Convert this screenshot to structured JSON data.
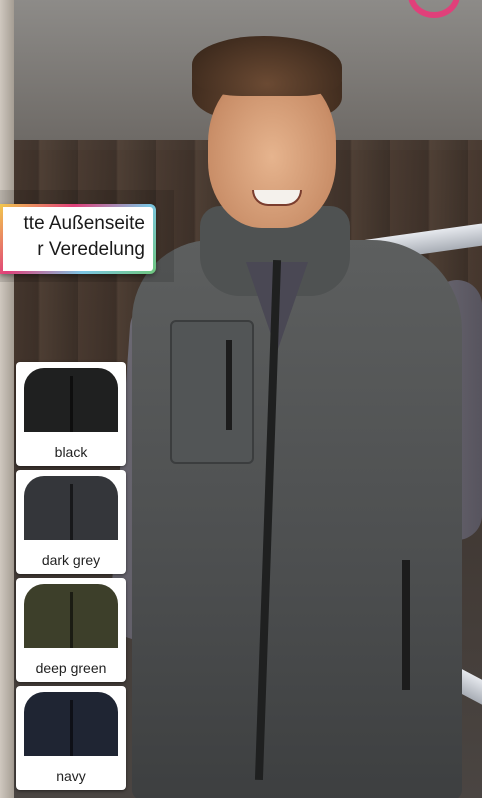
{
  "promo": {
    "line1": "tte Außenseite",
    "line2": "r Veredelung"
  },
  "swatches": [
    {
      "label": "black",
      "color": "#1f2020"
    },
    {
      "label": "dark grey",
      "color": "#34363a"
    },
    {
      "label": "deep green",
      "color": "#3d3f2a"
    },
    {
      "label": "navy",
      "color": "#1f2533"
    }
  ]
}
